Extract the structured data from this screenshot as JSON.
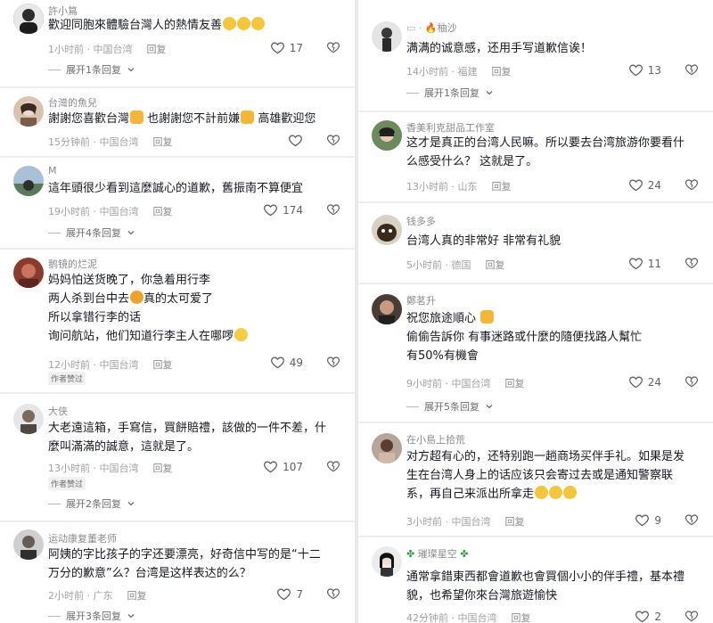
{
  "colors": {
    "text": "#161823",
    "meta": "#a0a1a7",
    "name": "#8a8b91",
    "divider": "#e9e9ec"
  },
  "left": [
    {
      "name": "許小䉆",
      "lines": [
        "歡迎同胞來體驗台灣人的熱情友善"
      ],
      "emoji": [
        "crying-face",
        "crying-face",
        "crying-face"
      ],
      "time": "1小时前",
      "loc": "中国台湾",
      "reply": "回复",
      "likes": "17",
      "expand": "展开1条回复"
    },
    {
      "name": "台灣的魚兒",
      "lines": [
        "謝謝您喜歡台灣",
        "也謝謝您不計前嫌",
        "高雄歡迎您"
      ],
      "time": "15分钟前",
      "loc": "中国台湾",
      "reply": "回复",
      "likes": ""
    },
    {
      "name": "M",
      "lines": [
        "這年頭很少看到這麼誠心的道歉，舊振南不算便宜"
      ],
      "time": "19小时前",
      "loc": "中国台湾",
      "reply": "回复",
      "likes": "174",
      "expand": "展开4条回复"
    },
    {
      "name": "鹅镜的烂泥",
      "lines": [
        "妈妈怕送货晚了，你急着用行李",
        "两人杀到台中去",
        "真的太可爱了",
        "所以拿错行李的话",
        "询问航站，他们知道行李主人在哪啰"
      ],
      "time": "12小时前",
      "loc": "中国台湾",
      "reply": "回复",
      "likes": "49",
      "badge": "作者赞过"
    },
    {
      "name": "大侠",
      "lines": [
        "大老遠這箱，手寫信，買餅賠禮，該做的一件不差，什",
        "麼叫滿滿的誠意，這就是了。"
      ],
      "time": "13小时前",
      "loc": "中国台湾",
      "reply": "回复",
      "likes": "107",
      "badge": "作者赞过",
      "expand": "展开2条回复"
    },
    {
      "name": "运动康复董老师",
      "lines": [
        "阿姨的字比孩子的字还要漂亮，好奇信中写的是“十二",
        "万分的歉意”么？台湾是这样表达的么？"
      ],
      "time": "2小时前",
      "loc": "广东",
      "reply": "回复",
      "likes": "7",
      "expand": "展开3条回复"
    }
  ],
  "right": [
    {
      "name": "柚沙",
      "lines": [
        "满满的诚意感，还用手写道歉信诶！"
      ],
      "time": "14小时前",
      "loc": "福建",
      "reply": "回复",
      "likes": "13",
      "expand": "展开1条回复"
    },
    {
      "name": "香美利克甜品工作室",
      "lines": [
        "这才是真正的台湾人民嘛。所以要去台湾旅游你要看什",
        "么感受什么？ 这就是了。"
      ],
      "time": "13小时前",
      "loc": "山东",
      "reply": "回复",
      "likes": "24"
    },
    {
      "name": "钱多多",
      "lines": [
        "台湾人真的非常好 非常有礼貌"
      ],
      "time": "5小时前",
      "loc": "德国",
      "reply": "回复",
      "likes": "11"
    },
    {
      "name": "鄭茗升",
      "lines": [
        "祝您旅途順心",
        "偷偷告訴你 有事迷路或什麼的隨便找路人幫忙",
        "有50%有機會"
      ],
      "time": "9小时前",
      "loc": "中国台湾",
      "reply": "回复",
      "likes": "24",
      "expand": "展开5条回复"
    },
    {
      "name": "在小島上拾荒",
      "lines": [
        "对方超有心的，还特别跑一趟商场买伴手礼。如果是发",
        "生在台湾人身上的话应该只会寄过去或是通知警察联",
        "系，再自己来派出所拿走"
      ],
      "time": "3小时前",
      "loc": "中国台湾",
      "reply": "回复",
      "likes": "9"
    },
    {
      "name": "璀璨星空",
      "lines": [
        "通常拿錯東西都會道歉也會買個小小的伴手禮，基本禮",
        "貌，也希望你來台灣旅遊愉快"
      ],
      "time": "42分钟前",
      "loc": "中国台湾",
      "reply": "回复",
      "likes": "2"
    }
  ]
}
